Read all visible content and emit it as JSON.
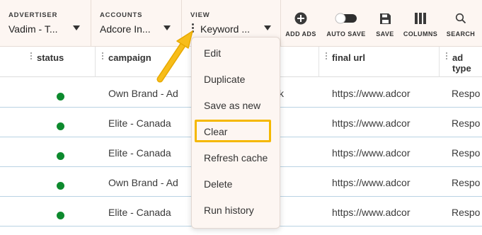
{
  "toolbar": {
    "advertiser": {
      "label": "ADVERTISER",
      "value": "Vadim - T..."
    },
    "accounts": {
      "label": "ACCOUNTS",
      "value": "Adcore In..."
    },
    "view": {
      "label": "VIEW",
      "value": "Keyword ..."
    },
    "buttons": {
      "add_ads": "ADD ADS",
      "auto_save": "AUTO SAVE",
      "save": "SAVE",
      "columns": "COLUMNS",
      "search": "SEARCH"
    },
    "auto_save_on": false
  },
  "grid": {
    "columns": [
      "status",
      "campaign",
      "final url",
      "ad type"
    ],
    "rows": [
      {
        "status": "active",
        "campaign": "Own Brand - Ad",
        "final_url": "https://www.adcor",
        "ad_type": "Respo"
      },
      {
        "status": "active",
        "campaign": "Elite - Canada",
        "final_url": "https://www.adcor",
        "ad_type": "Respo"
      },
      {
        "status": "active",
        "campaign": "Elite - Canada",
        "final_url": "https://www.adcor",
        "ad_type": "Respo"
      },
      {
        "status": "active",
        "campaign": "Own Brand - Ad",
        "final_url": "https://www.adcor",
        "ad_type": "Respo"
      },
      {
        "status": "active",
        "campaign": "Elite - Canada",
        "final_url": "https://www.adcor",
        "ad_type": "Respo"
      }
    ],
    "partial_text_row1": "k"
  },
  "view_menu": {
    "items": [
      "Edit",
      "Duplicate",
      "Save as new",
      "Clear",
      "Refresh cache",
      "Delete",
      "Run history"
    ],
    "highlighted": "Clear"
  },
  "colors": {
    "toolbar_bg": "#fdf6f2",
    "status_active": "#0d8a2e",
    "highlight": "#f5b800",
    "row_border": "#b9d3e3"
  }
}
